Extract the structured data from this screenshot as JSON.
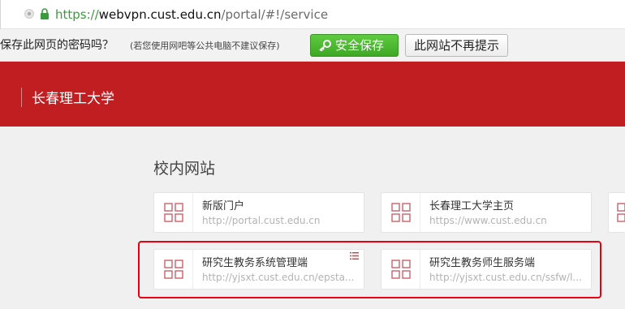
{
  "browser": {
    "url_scheme": "https://",
    "url_host": "webvpn.cust.edu.cn",
    "url_path": "/portal/#!/service"
  },
  "password_bar": {
    "question": "保存此网页的密码吗？",
    "note": "(若您使用网吧等公共电脑不建议保存)",
    "save_label": "安全保存",
    "never_label": "此网站不再提示"
  },
  "header": {
    "title": "长春理工大学",
    "color": "#c11e22"
  },
  "section": {
    "title": "校内网站"
  },
  "sites": [
    {
      "name": "新版门户",
      "url": "http://portal.cust.edu.cn"
    },
    {
      "name": "长春理工大学主页",
      "url": "https://www.cust.edu.cn"
    },
    {
      "name": "研究生教务系统管理端",
      "url": "http://yjsxt.cust.edu.cn/epsta..."
    },
    {
      "name": "研究生教务师生服务端",
      "url": "http://yjsxt.cust.edu.cn/ssfw/l..."
    }
  ],
  "icons": {
    "site_icon": "grid-apps-icon",
    "menu": "list-menu-icon",
    "lock": "lock-icon",
    "key": "key-icon"
  },
  "colors": {
    "accent_red": "#c11e22",
    "save_green": "#4cb92f",
    "highlight_red": "#e60012"
  }
}
